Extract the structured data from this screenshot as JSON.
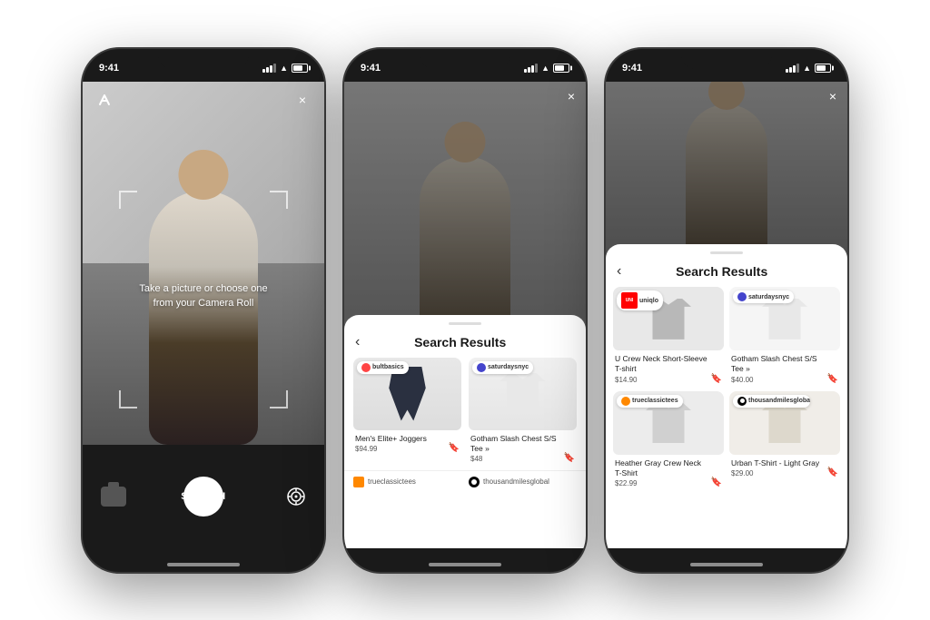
{
  "phones": [
    {
      "id": "phone1",
      "status": {
        "time": "9:41",
        "signal": true,
        "wifi": true,
        "battery": true
      },
      "screen": "camera",
      "camera": {
        "close_label": "×",
        "brand_icon": "//",
        "instruction_text": "Take a picture or choose one from your Camera Roll",
        "search_label": "SEARCH"
      }
    },
    {
      "id": "phone2",
      "status": {
        "time": "9:41",
        "signal": true,
        "wifi": true,
        "battery": true
      },
      "screen": "results_partial",
      "close_label": "×",
      "back_label": "‹",
      "results_title": "Search Results",
      "products": [
        {
          "brand": "bultbasics",
          "brand_color": "red",
          "name": "Men's Elite+ Joggers",
          "price": "$94.99",
          "type": "joggers"
        },
        {
          "brand": "saturdaysnyc",
          "brand_color": "blue",
          "name": "Gotham Slash Chest S/S Tee »",
          "price": "$48",
          "type": "tee"
        }
      ],
      "more_brands": [
        "trueclassictees",
        "thousandmilesglobal"
      ]
    },
    {
      "id": "phone3",
      "status": {
        "time": "9:41",
        "signal": true,
        "wifi": true,
        "battery": true
      },
      "screen": "results_full",
      "close_label": "×",
      "back_label": "‹",
      "results_title": "Search Results",
      "products": [
        {
          "brand": "uniqlo",
          "brand_label": "UNI\nQLO",
          "brand_color": "red",
          "name": "U Crew Neck Short-Sleeve T-shirt",
          "price": "$14.90",
          "type": "tee_gray",
          "bookmark": true
        },
        {
          "brand": "saturdaysnyc",
          "brand_color": "blue",
          "name": "Gotham Slash Chest S/S Tee »",
          "price": "$40.00",
          "type": "tee_white",
          "bookmark": true
        },
        {
          "brand": "trueclassictees",
          "brand_color": "orange",
          "name": "Heather Gray Crew Neck T-Shirt",
          "price": "$22.99",
          "type": "tee_lightgray",
          "bookmark": true
        },
        {
          "brand": "thousandmilesglobal",
          "brand_color": "black",
          "name": "Urban T-Shirt - Light Gray",
          "price": "$29.00",
          "type": "tee_cream",
          "bookmark": true
        }
      ]
    }
  ]
}
